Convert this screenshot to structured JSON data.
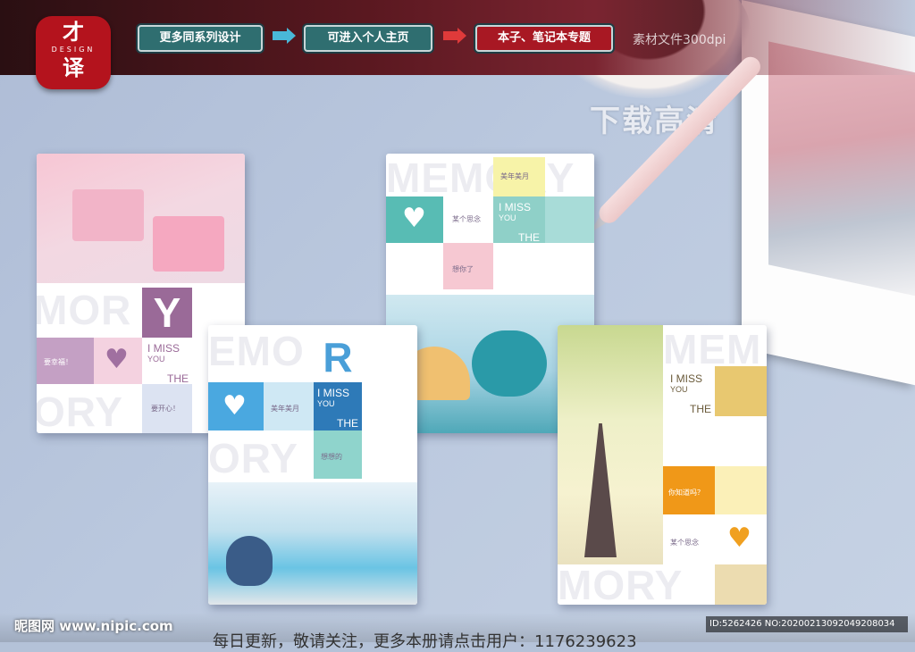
{
  "header": {
    "logo_top": "才",
    "logo_mid": "DESIGN",
    "logo_bottom": "译",
    "nav": [
      "更多同系列设计",
      "可进入个人主页",
      "本子、笔记本专题"
    ],
    "note": "素材文件300dpi"
  },
  "watermark_text": "下载高清",
  "books": [
    {
      "letter": "Y",
      "miss": "I MISS",
      "you": "YOU",
      "the": "THE",
      "cn1": "要幸福！",
      "cn2": "要开心！",
      "big1": "MOR",
      "big2": "ORY"
    },
    {
      "letters": "MEMORY",
      "miss": "I MISS",
      "you": "YOU",
      "the": "THE",
      "cn1": "某个思念",
      "cn2": "美年美月",
      "cn3": "想你了"
    },
    {
      "letter": "R",
      "miss": "I MISS",
      "you": "YOU",
      "the": "THE",
      "cn1": "美年美月",
      "cn2": "想想的",
      "big1": "EMO",
      "big2": "ORY"
    },
    {
      "miss": "I MISS",
      "you": "YOU",
      "the": "THE",
      "cn1": "你知道吗？",
      "cn2": "某个思念",
      "big1": "MEM",
      "big2": "MORY"
    }
  ],
  "footer": {
    "site": "昵图网 www.nipic.com",
    "slogan": "每日更新，敬请关注，更多本册请点击用户：1176239623",
    "id": "ID:5262426 NO:20200213092049208034"
  },
  "colors": {
    "brand_red": "#b4131d",
    "teal": "#2f6e70",
    "purple": "#9a6a98",
    "blue": "#4a9fd8",
    "orange": "#f0a020"
  }
}
